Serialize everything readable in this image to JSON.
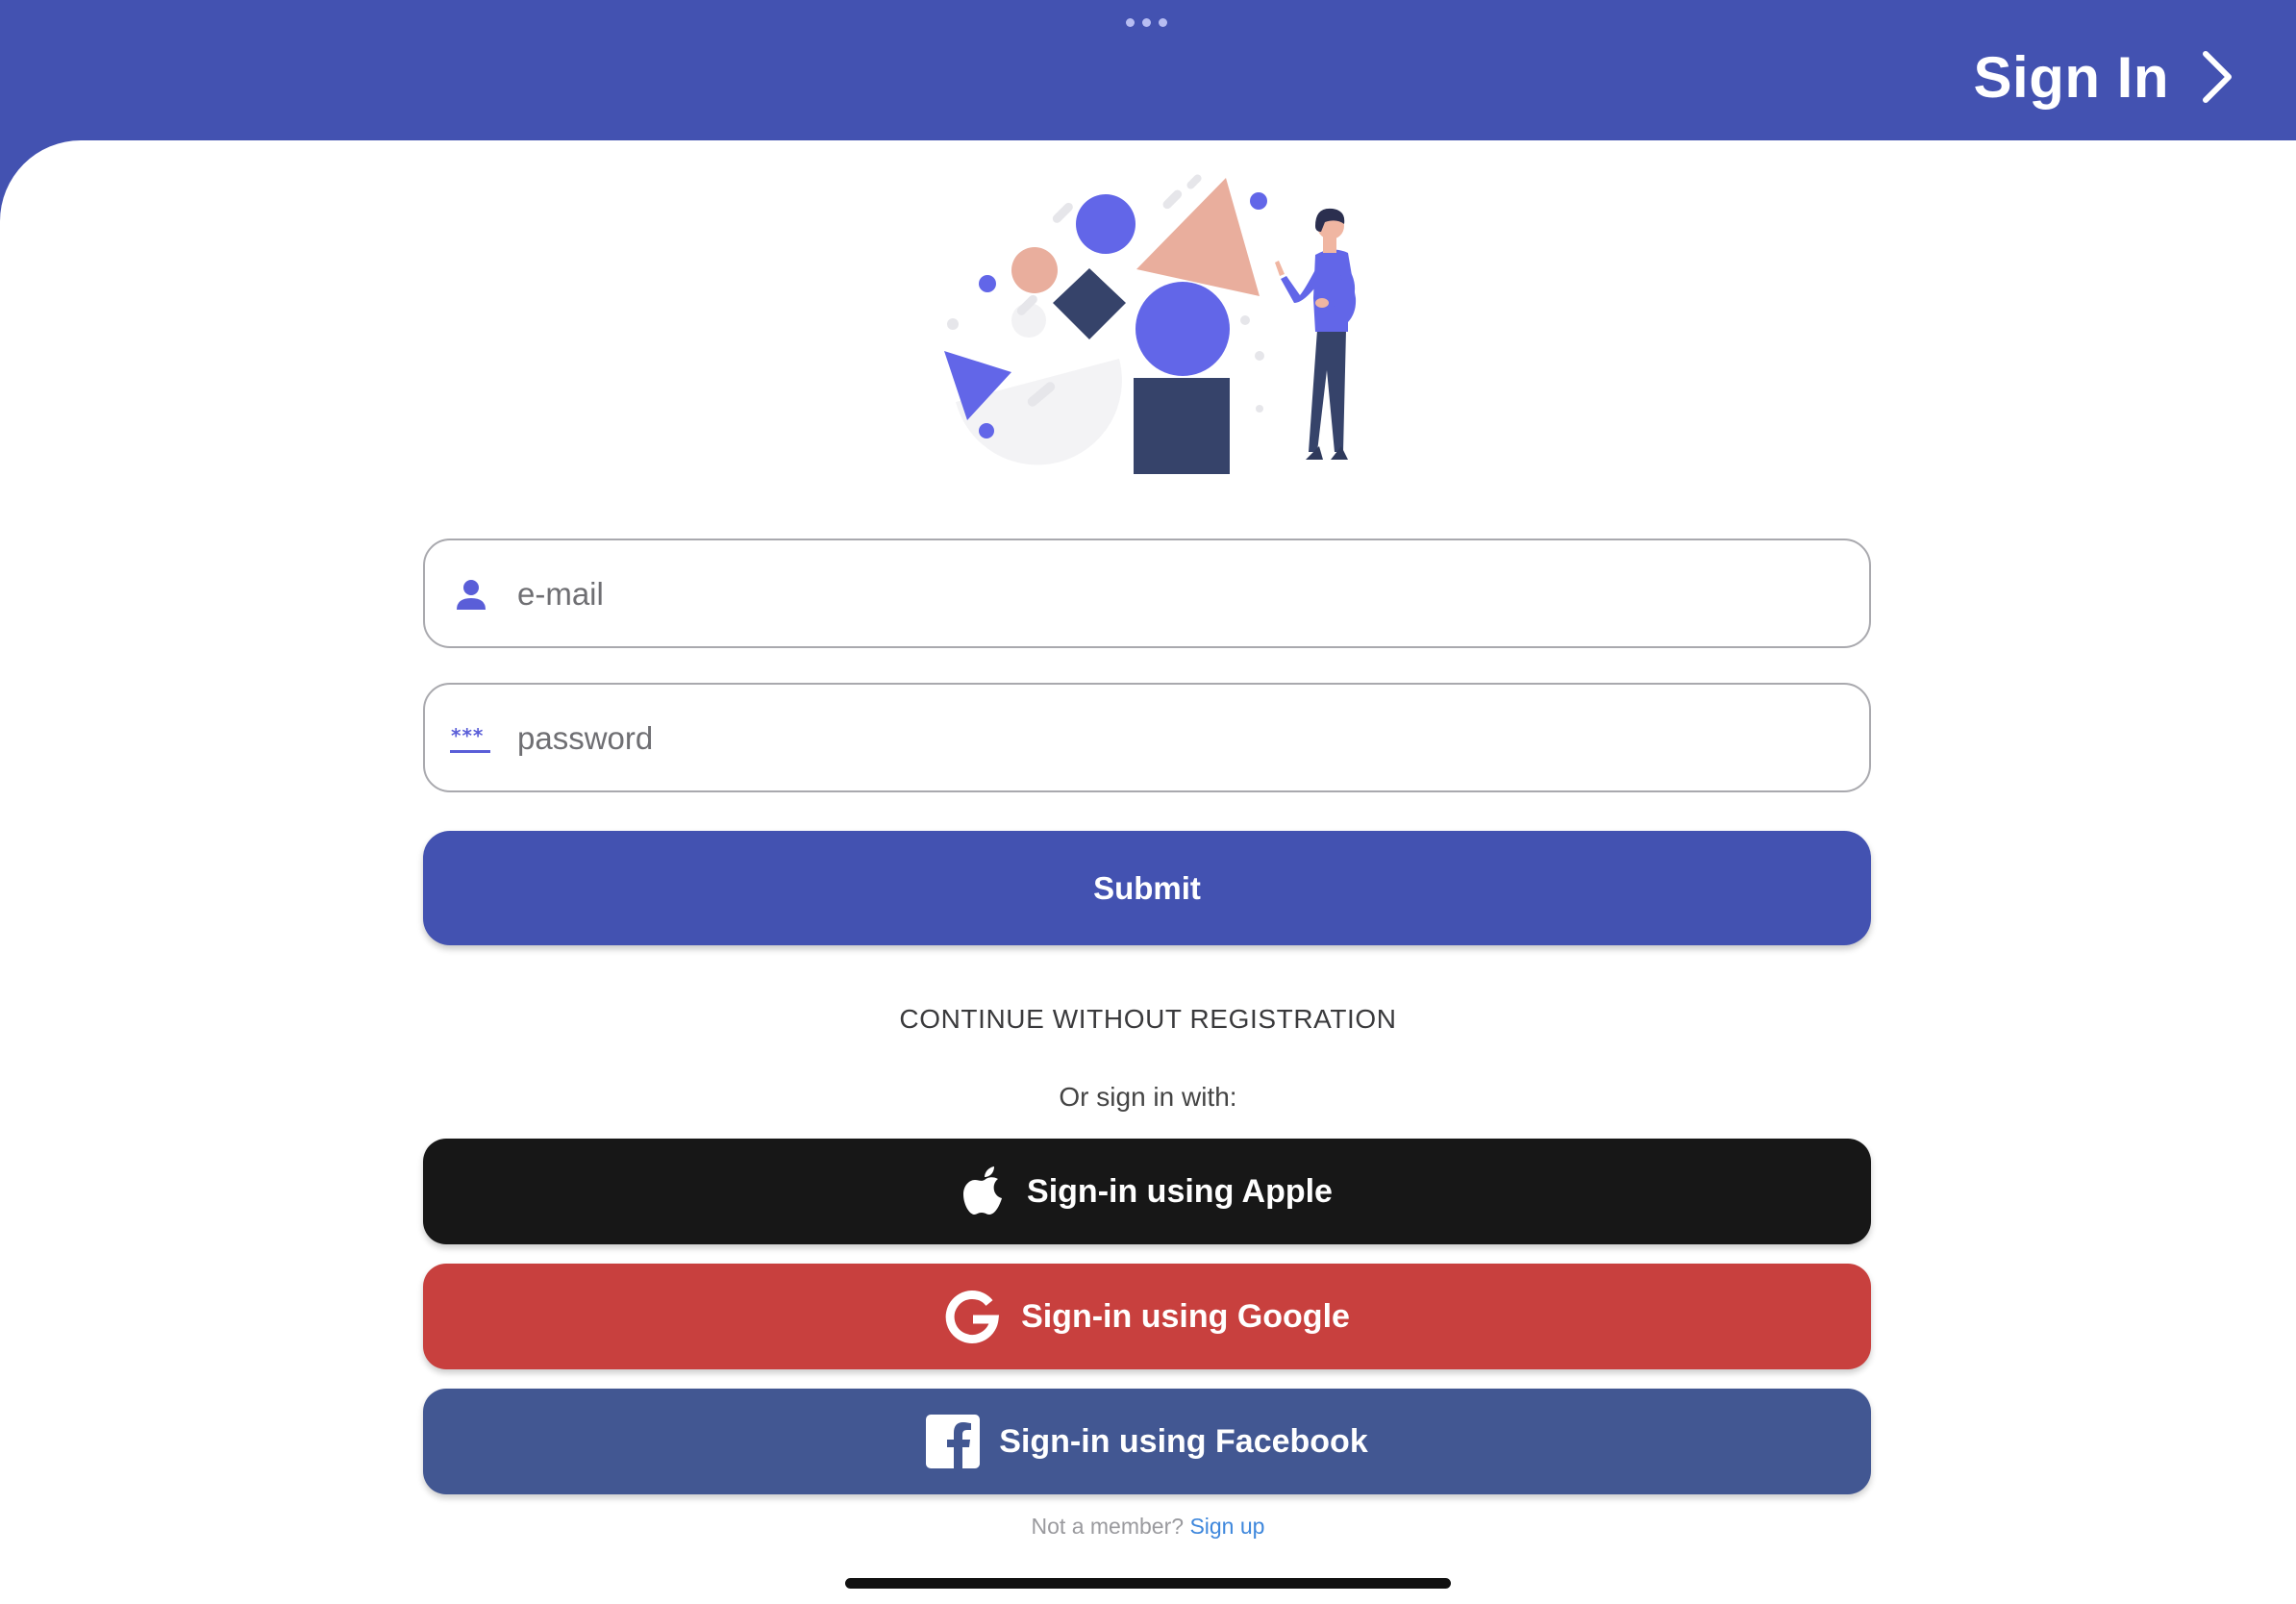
{
  "header": {
    "title": "Sign In",
    "chevron_icon": "chevron-right-icon",
    "more_icon": "ellipsis-icon"
  },
  "illustration": {
    "name": "person-with-shapes-illustration"
  },
  "form": {
    "email": {
      "placeholder": "e-mail",
      "value": "",
      "icon": "user-icon"
    },
    "password": {
      "placeholder": "password",
      "value": "",
      "icon": "password-icon"
    },
    "submit_label": "Submit"
  },
  "continue_label": "CONTINUE WITHOUT REGISTRATION",
  "or_label": "Or sign in with:",
  "social": {
    "apple": {
      "label": "Sign-in using Apple",
      "icon": "apple-icon"
    },
    "google": {
      "label": "Sign-in using Google",
      "icon": "google-icon"
    },
    "facebook": {
      "label": "Sign-in using Facebook",
      "icon": "facebook-icon"
    }
  },
  "footer": {
    "prompt": "Not a member? ",
    "link_label": "Sign up"
  },
  "colors": {
    "primary": "#4352b1",
    "apple": "#171717",
    "google": "#c8403e",
    "facebook": "#425792",
    "link": "#3e87dc",
    "accent_shape": "#6266e8",
    "peach_shape": "#e9ae9d",
    "navy_shape": "#36436a"
  }
}
